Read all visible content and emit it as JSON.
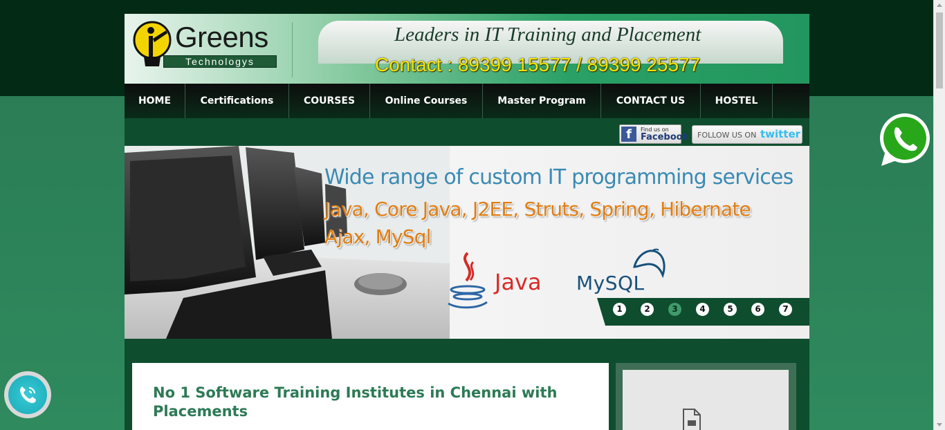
{
  "brand": {
    "name": "Greens",
    "tag": "Technologys",
    "tagline": "Leaders in IT Training and Placement",
    "contact": "Contact : 89399 15577 / 89399 25577"
  },
  "nav": {
    "items": [
      {
        "label": "HOME"
      },
      {
        "label": "Certifications"
      },
      {
        "label": "COURSES"
      },
      {
        "label": "Online Courses"
      },
      {
        "label": "Master Program"
      },
      {
        "label": "CONTACT US"
      },
      {
        "label": "HOSTEL"
      }
    ]
  },
  "social": {
    "facebook_small": "Find us on",
    "facebook_big": "Facebook",
    "facebook_letter": "f",
    "twitter_follow": "FOLLOW US ON",
    "twitter_name": "twitter"
  },
  "slider": {
    "title": "Wide range of custom IT programming services",
    "line1": "Java, Core Java, J2EE, Struts, Spring, Hibernate",
    "line2": "Ajax, MySql",
    "java_label": "Java",
    "mysql_label": "MySQL",
    "pages": [
      "1",
      "2",
      "3",
      "4",
      "5",
      "6",
      "7"
    ],
    "active_page": "3"
  },
  "main": {
    "title": "No 1 Software Training Institutes in Chennai with Placements"
  },
  "colors": {
    "brand_green": "#2d7a55",
    "contact_yellow": "#f5e500",
    "slider_title_blue": "#3a8ab4",
    "slider_sub_orange": "#e07d10"
  },
  "icons": {
    "whatsapp": "whatsapp-icon",
    "call": "phone-call-icon",
    "document": "document-icon"
  }
}
